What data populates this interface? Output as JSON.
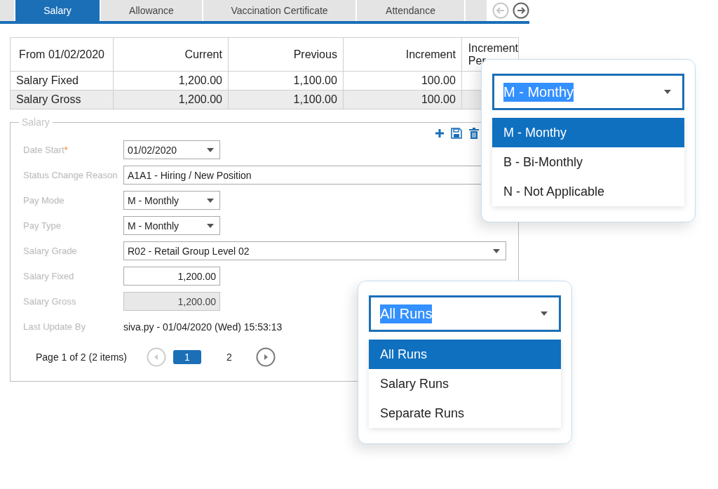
{
  "tabs": [
    {
      "label": "Salary",
      "selected": true
    },
    {
      "label": "Allowance",
      "selected": false
    },
    {
      "label": "Vaccination Certificate",
      "selected": false
    },
    {
      "label": "Attendance",
      "selected": false
    }
  ],
  "tab_scroll": [
    {
      "kind": "prev",
      "disabled": true
    },
    {
      "kind": "next",
      "disabled": false
    }
  ],
  "table": {
    "columns": [
      "From 01/02/2020",
      "Current",
      "Previous",
      "Increment",
      "Increment Per"
    ],
    "rows": [
      {
        "cells": [
          "Salary Fixed",
          "1,200.00",
          "1,100.00",
          "100.00"
        ],
        "selected": false
      },
      {
        "cells": [
          "Salary Gross",
          "1,200.00",
          "1,100.00",
          "100.00"
        ],
        "selected": true
      }
    ]
  },
  "salary_form": {
    "legend": "Salary",
    "toolbar": [
      {
        "kind": "add"
      },
      {
        "kind": "save"
      },
      {
        "kind": "delete"
      }
    ],
    "fields": [
      {
        "label": "Date Start",
        "required_mark": "*",
        "kind": "dropdown",
        "value": "01/02/2020"
      },
      {
        "label": "Status Change Reason",
        "kind": "text",
        "value": "A1A1 - Hiring / New Position"
      },
      {
        "label": "Pay Mode",
        "kind": "dropdown",
        "value": "M - Monthly"
      },
      {
        "label": "Pay Type",
        "kind": "dropdown",
        "value": "M - Monthly"
      },
      {
        "label": "Salary Grade",
        "kind": "wide-dropdown",
        "value": "R02 - Retail Group Level 02"
      },
      {
        "label": "Salary Fixed",
        "kind": "number",
        "value": "1,200.00",
        "disabled": false
      },
      {
        "label": "Salary Gross",
        "kind": "number",
        "value": "1,200.00",
        "disabled": true
      },
      {
        "label": "Last Update By",
        "kind": "info",
        "value": "siva.py - 01/04/2020 (Wed) 15:53:13"
      }
    ],
    "pager": {
      "summary": "Page 1 of 2 (2 items)",
      "prev": {
        "disabled": true
      },
      "next": {
        "disabled": false
      },
      "pages": [
        {
          "label": "1",
          "selected": true
        },
        {
          "label": "2",
          "selected": false
        }
      ]
    }
  },
  "dropdown_popups": [
    {
      "value": "M - Monthy",
      "options": [
        {
          "label": "M - Monthy",
          "selected": true
        },
        {
          "label": "B - Bi-Monthly",
          "selected": false
        },
        {
          "label": "N - Not Applicable",
          "selected": false
        }
      ]
    },
    {
      "value": "All Runs",
      "options": [
        {
          "label": "All Runs",
          "selected": true
        },
        {
          "label": "Salary Runs",
          "selected": false
        },
        {
          "label": "Separate Runs",
          "selected": false
        }
      ]
    }
  ]
}
